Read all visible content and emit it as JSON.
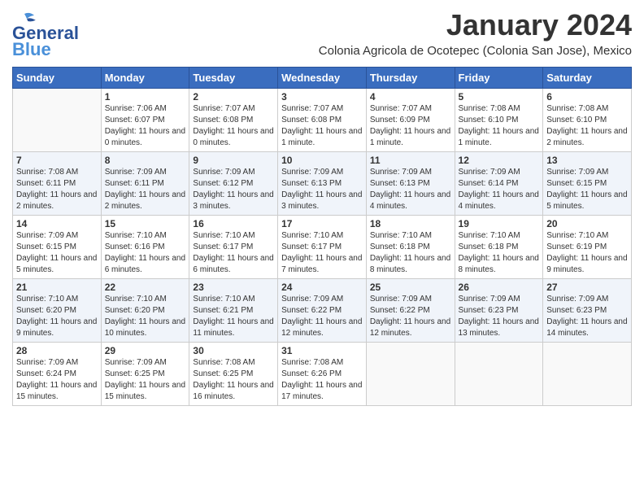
{
  "logo": {
    "text_general": "General",
    "text_blue": "Blue"
  },
  "title": "January 2024",
  "location": "Colonia Agricola de Ocotepec (Colonia San Jose), Mexico",
  "days_header": [
    "Sunday",
    "Monday",
    "Tuesday",
    "Wednesday",
    "Thursday",
    "Friday",
    "Saturday"
  ],
  "weeks": [
    [
      {
        "day": "",
        "sunrise": "",
        "sunset": "",
        "daylight": ""
      },
      {
        "day": "1",
        "sunrise": "Sunrise: 7:06 AM",
        "sunset": "Sunset: 6:07 PM",
        "daylight": "Daylight: 11 hours and 0 minutes."
      },
      {
        "day": "2",
        "sunrise": "Sunrise: 7:07 AM",
        "sunset": "Sunset: 6:08 PM",
        "daylight": "Daylight: 11 hours and 0 minutes."
      },
      {
        "day": "3",
        "sunrise": "Sunrise: 7:07 AM",
        "sunset": "Sunset: 6:08 PM",
        "daylight": "Daylight: 11 hours and 1 minute."
      },
      {
        "day": "4",
        "sunrise": "Sunrise: 7:07 AM",
        "sunset": "Sunset: 6:09 PM",
        "daylight": "Daylight: 11 hours and 1 minute."
      },
      {
        "day": "5",
        "sunrise": "Sunrise: 7:08 AM",
        "sunset": "Sunset: 6:10 PM",
        "daylight": "Daylight: 11 hours and 1 minute."
      },
      {
        "day": "6",
        "sunrise": "Sunrise: 7:08 AM",
        "sunset": "Sunset: 6:10 PM",
        "daylight": "Daylight: 11 hours and 2 minutes."
      }
    ],
    [
      {
        "day": "7",
        "sunrise": "Sunrise: 7:08 AM",
        "sunset": "Sunset: 6:11 PM",
        "daylight": "Daylight: 11 hours and 2 minutes."
      },
      {
        "day": "8",
        "sunrise": "Sunrise: 7:09 AM",
        "sunset": "Sunset: 6:11 PM",
        "daylight": "Daylight: 11 hours and 2 minutes."
      },
      {
        "day": "9",
        "sunrise": "Sunrise: 7:09 AM",
        "sunset": "Sunset: 6:12 PM",
        "daylight": "Daylight: 11 hours and 3 minutes."
      },
      {
        "day": "10",
        "sunrise": "Sunrise: 7:09 AM",
        "sunset": "Sunset: 6:13 PM",
        "daylight": "Daylight: 11 hours and 3 minutes."
      },
      {
        "day": "11",
        "sunrise": "Sunrise: 7:09 AM",
        "sunset": "Sunset: 6:13 PM",
        "daylight": "Daylight: 11 hours and 4 minutes."
      },
      {
        "day": "12",
        "sunrise": "Sunrise: 7:09 AM",
        "sunset": "Sunset: 6:14 PM",
        "daylight": "Daylight: 11 hours and 4 minutes."
      },
      {
        "day": "13",
        "sunrise": "Sunrise: 7:09 AM",
        "sunset": "Sunset: 6:15 PM",
        "daylight": "Daylight: 11 hours and 5 minutes."
      }
    ],
    [
      {
        "day": "14",
        "sunrise": "Sunrise: 7:09 AM",
        "sunset": "Sunset: 6:15 PM",
        "daylight": "Daylight: 11 hours and 5 minutes."
      },
      {
        "day": "15",
        "sunrise": "Sunrise: 7:10 AM",
        "sunset": "Sunset: 6:16 PM",
        "daylight": "Daylight: 11 hours and 6 minutes."
      },
      {
        "day": "16",
        "sunrise": "Sunrise: 7:10 AM",
        "sunset": "Sunset: 6:17 PM",
        "daylight": "Daylight: 11 hours and 6 minutes."
      },
      {
        "day": "17",
        "sunrise": "Sunrise: 7:10 AM",
        "sunset": "Sunset: 6:17 PM",
        "daylight": "Daylight: 11 hours and 7 minutes."
      },
      {
        "day": "18",
        "sunrise": "Sunrise: 7:10 AM",
        "sunset": "Sunset: 6:18 PM",
        "daylight": "Daylight: 11 hours and 8 minutes."
      },
      {
        "day": "19",
        "sunrise": "Sunrise: 7:10 AM",
        "sunset": "Sunset: 6:18 PM",
        "daylight": "Daylight: 11 hours and 8 minutes."
      },
      {
        "day": "20",
        "sunrise": "Sunrise: 7:10 AM",
        "sunset": "Sunset: 6:19 PM",
        "daylight": "Daylight: 11 hours and 9 minutes."
      }
    ],
    [
      {
        "day": "21",
        "sunrise": "Sunrise: 7:10 AM",
        "sunset": "Sunset: 6:20 PM",
        "daylight": "Daylight: 11 hours and 9 minutes."
      },
      {
        "day": "22",
        "sunrise": "Sunrise: 7:10 AM",
        "sunset": "Sunset: 6:20 PM",
        "daylight": "Daylight: 11 hours and 10 minutes."
      },
      {
        "day": "23",
        "sunrise": "Sunrise: 7:10 AM",
        "sunset": "Sunset: 6:21 PM",
        "daylight": "Daylight: 11 hours and 11 minutes."
      },
      {
        "day": "24",
        "sunrise": "Sunrise: 7:09 AM",
        "sunset": "Sunset: 6:22 PM",
        "daylight": "Daylight: 11 hours and 12 minutes."
      },
      {
        "day": "25",
        "sunrise": "Sunrise: 7:09 AM",
        "sunset": "Sunset: 6:22 PM",
        "daylight": "Daylight: 11 hours and 12 minutes."
      },
      {
        "day": "26",
        "sunrise": "Sunrise: 7:09 AM",
        "sunset": "Sunset: 6:23 PM",
        "daylight": "Daylight: 11 hours and 13 minutes."
      },
      {
        "day": "27",
        "sunrise": "Sunrise: 7:09 AM",
        "sunset": "Sunset: 6:23 PM",
        "daylight": "Daylight: 11 hours and 14 minutes."
      }
    ],
    [
      {
        "day": "28",
        "sunrise": "Sunrise: 7:09 AM",
        "sunset": "Sunset: 6:24 PM",
        "daylight": "Daylight: 11 hours and 15 minutes."
      },
      {
        "day": "29",
        "sunrise": "Sunrise: 7:09 AM",
        "sunset": "Sunset: 6:25 PM",
        "daylight": "Daylight: 11 hours and 15 minutes."
      },
      {
        "day": "30",
        "sunrise": "Sunrise: 7:08 AM",
        "sunset": "Sunset: 6:25 PM",
        "daylight": "Daylight: 11 hours and 16 minutes."
      },
      {
        "day": "31",
        "sunrise": "Sunrise: 7:08 AM",
        "sunset": "Sunset: 6:26 PM",
        "daylight": "Daylight: 11 hours and 17 minutes."
      },
      {
        "day": "",
        "sunrise": "",
        "sunset": "",
        "daylight": ""
      },
      {
        "day": "",
        "sunrise": "",
        "sunset": "",
        "daylight": ""
      },
      {
        "day": "",
        "sunrise": "",
        "sunset": "",
        "daylight": ""
      }
    ]
  ]
}
